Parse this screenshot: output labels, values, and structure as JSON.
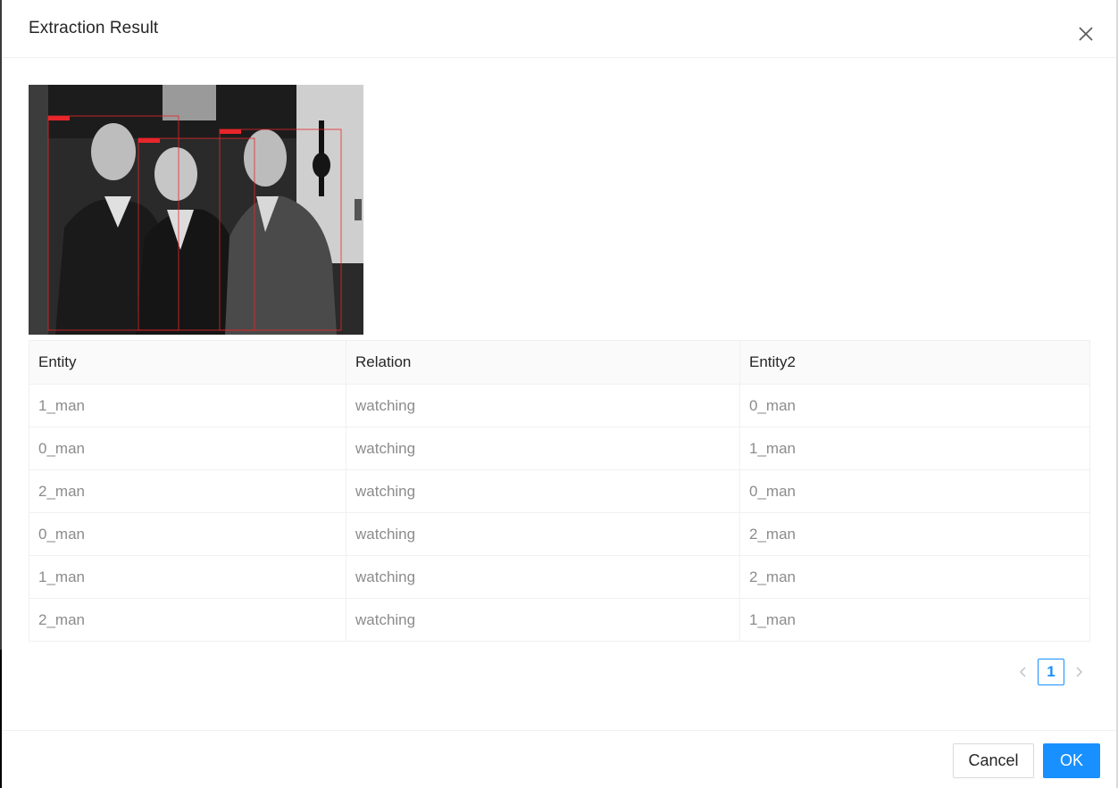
{
  "modal": {
    "title": "Extraction Result",
    "close_icon": "close-icon"
  },
  "image": {
    "description_icon": "photo",
    "box_labels": [
      "1_man",
      "0_man",
      "2_man"
    ],
    "box_color": "#e8262b"
  },
  "table": {
    "columns": [
      "Entity",
      "Relation",
      "Entity2"
    ],
    "rows": [
      [
        "1_man",
        "watching",
        "0_man"
      ],
      [
        "0_man",
        "watching",
        "1_man"
      ],
      [
        "2_man",
        "watching",
        "0_man"
      ],
      [
        "0_man",
        "watching",
        "2_man"
      ],
      [
        "1_man",
        "watching",
        "2_man"
      ],
      [
        "2_man",
        "watching",
        "1_man"
      ]
    ]
  },
  "pagination": {
    "current_page": "1",
    "prev_icon": "chevron-left-icon",
    "next_icon": "chevron-right-icon"
  },
  "footer": {
    "cancel_label": "Cancel",
    "ok_label": "OK"
  },
  "colors": {
    "primary": "#1890ff",
    "header_bg": "#fafafa",
    "cell_text": "#8c8c8c"
  }
}
